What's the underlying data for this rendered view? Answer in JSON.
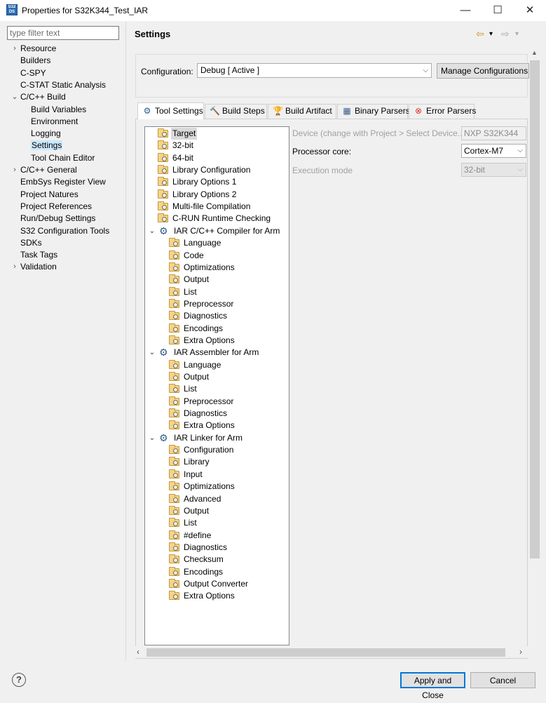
{
  "window": {
    "title": "Properties for S32K344_Test_IAR",
    "icon_text": "S32 DS",
    "controls": {
      "minimize": "—",
      "maximize": "☐",
      "close": "✕"
    }
  },
  "filter": {
    "placeholder": "type filter text"
  },
  "nav": {
    "items": [
      {
        "label": "Resource",
        "arrow": "›"
      },
      {
        "label": "Builders"
      },
      {
        "label": "C-SPY"
      },
      {
        "label": "C-STAT Static Analysis"
      },
      {
        "label": "C/C++ Build",
        "arrow": "⌄"
      },
      {
        "label": "Build Variables"
      },
      {
        "label": "Environment"
      },
      {
        "label": "Logging"
      },
      {
        "label": "Settings"
      },
      {
        "label": "Tool Chain Editor"
      },
      {
        "label": "C/C++ General",
        "arrow": "›"
      },
      {
        "label": "EmbSys Register View"
      },
      {
        "label": "Project Natures"
      },
      {
        "label": "Project References"
      },
      {
        "label": "Run/Debug Settings"
      },
      {
        "label": "S32 Configuration Tools"
      },
      {
        "label": "SDKs"
      },
      {
        "label": "Task Tags"
      },
      {
        "label": "Validation",
        "arrow": "›"
      }
    ],
    "selected": "Settings"
  },
  "header": {
    "title": "Settings",
    "back_icon": "⇦",
    "forward_icon": "⇨",
    "menu_icon": "▾"
  },
  "config": {
    "label": "Configuration:",
    "value": "Debug  [ Active ]",
    "manage_button": "Manage Configurations..."
  },
  "tabs": [
    {
      "label": "Tool Settings",
      "icon": "⚙"
    },
    {
      "label": "Build Steps",
      "icon": "🔨"
    },
    {
      "label": "Build Artifact",
      "icon": "🏆"
    },
    {
      "label": "Binary Parsers",
      "icon": "▦"
    },
    {
      "label": "Error Parsers",
      "icon": "⊗"
    }
  ],
  "active_tab": "Tool Settings",
  "tree": {
    "top_items": [
      "Target",
      "32-bit",
      "64-bit",
      "Library Configuration",
      "Library Options 1",
      "Library Options 2",
      "Multi-file Compilation",
      "C-RUN Runtime Checking"
    ],
    "compiler": {
      "label": "IAR C/C++ Compiler for Arm",
      "children": [
        "Language",
        "Code",
        "Optimizations",
        "Output",
        "List",
        "Preprocessor",
        "Diagnostics",
        "Encodings",
        "Extra Options"
      ]
    },
    "assembler": {
      "label": "IAR Assembler for Arm",
      "children": [
        "Language",
        "Output",
        "List",
        "Preprocessor",
        "Diagnostics",
        "Extra Options"
      ]
    },
    "linker": {
      "label": "IAR Linker for Arm",
      "children": [
        "Configuration",
        "Library",
        "Input",
        "Optimizations",
        "Advanced",
        "Output",
        "List",
        "#define",
        "Diagnostics",
        "Checksum",
        "Encodings",
        "Output Converter",
        "Extra Options"
      ]
    },
    "selected": "Target"
  },
  "target_settings": {
    "device_label": "Device (change with Project > Select Device...)",
    "device_value": "NXP S32K344",
    "core_label": "Processor core:",
    "core_value": "Cortex-M7",
    "mode_label": "Execution mode",
    "mode_value": "32-bit"
  },
  "buttons": {
    "help": "?",
    "apply_close": "Apply and Close",
    "cancel": "Cancel"
  },
  "scroll": {
    "left": "‹",
    "right": "›",
    "up": "▲"
  }
}
